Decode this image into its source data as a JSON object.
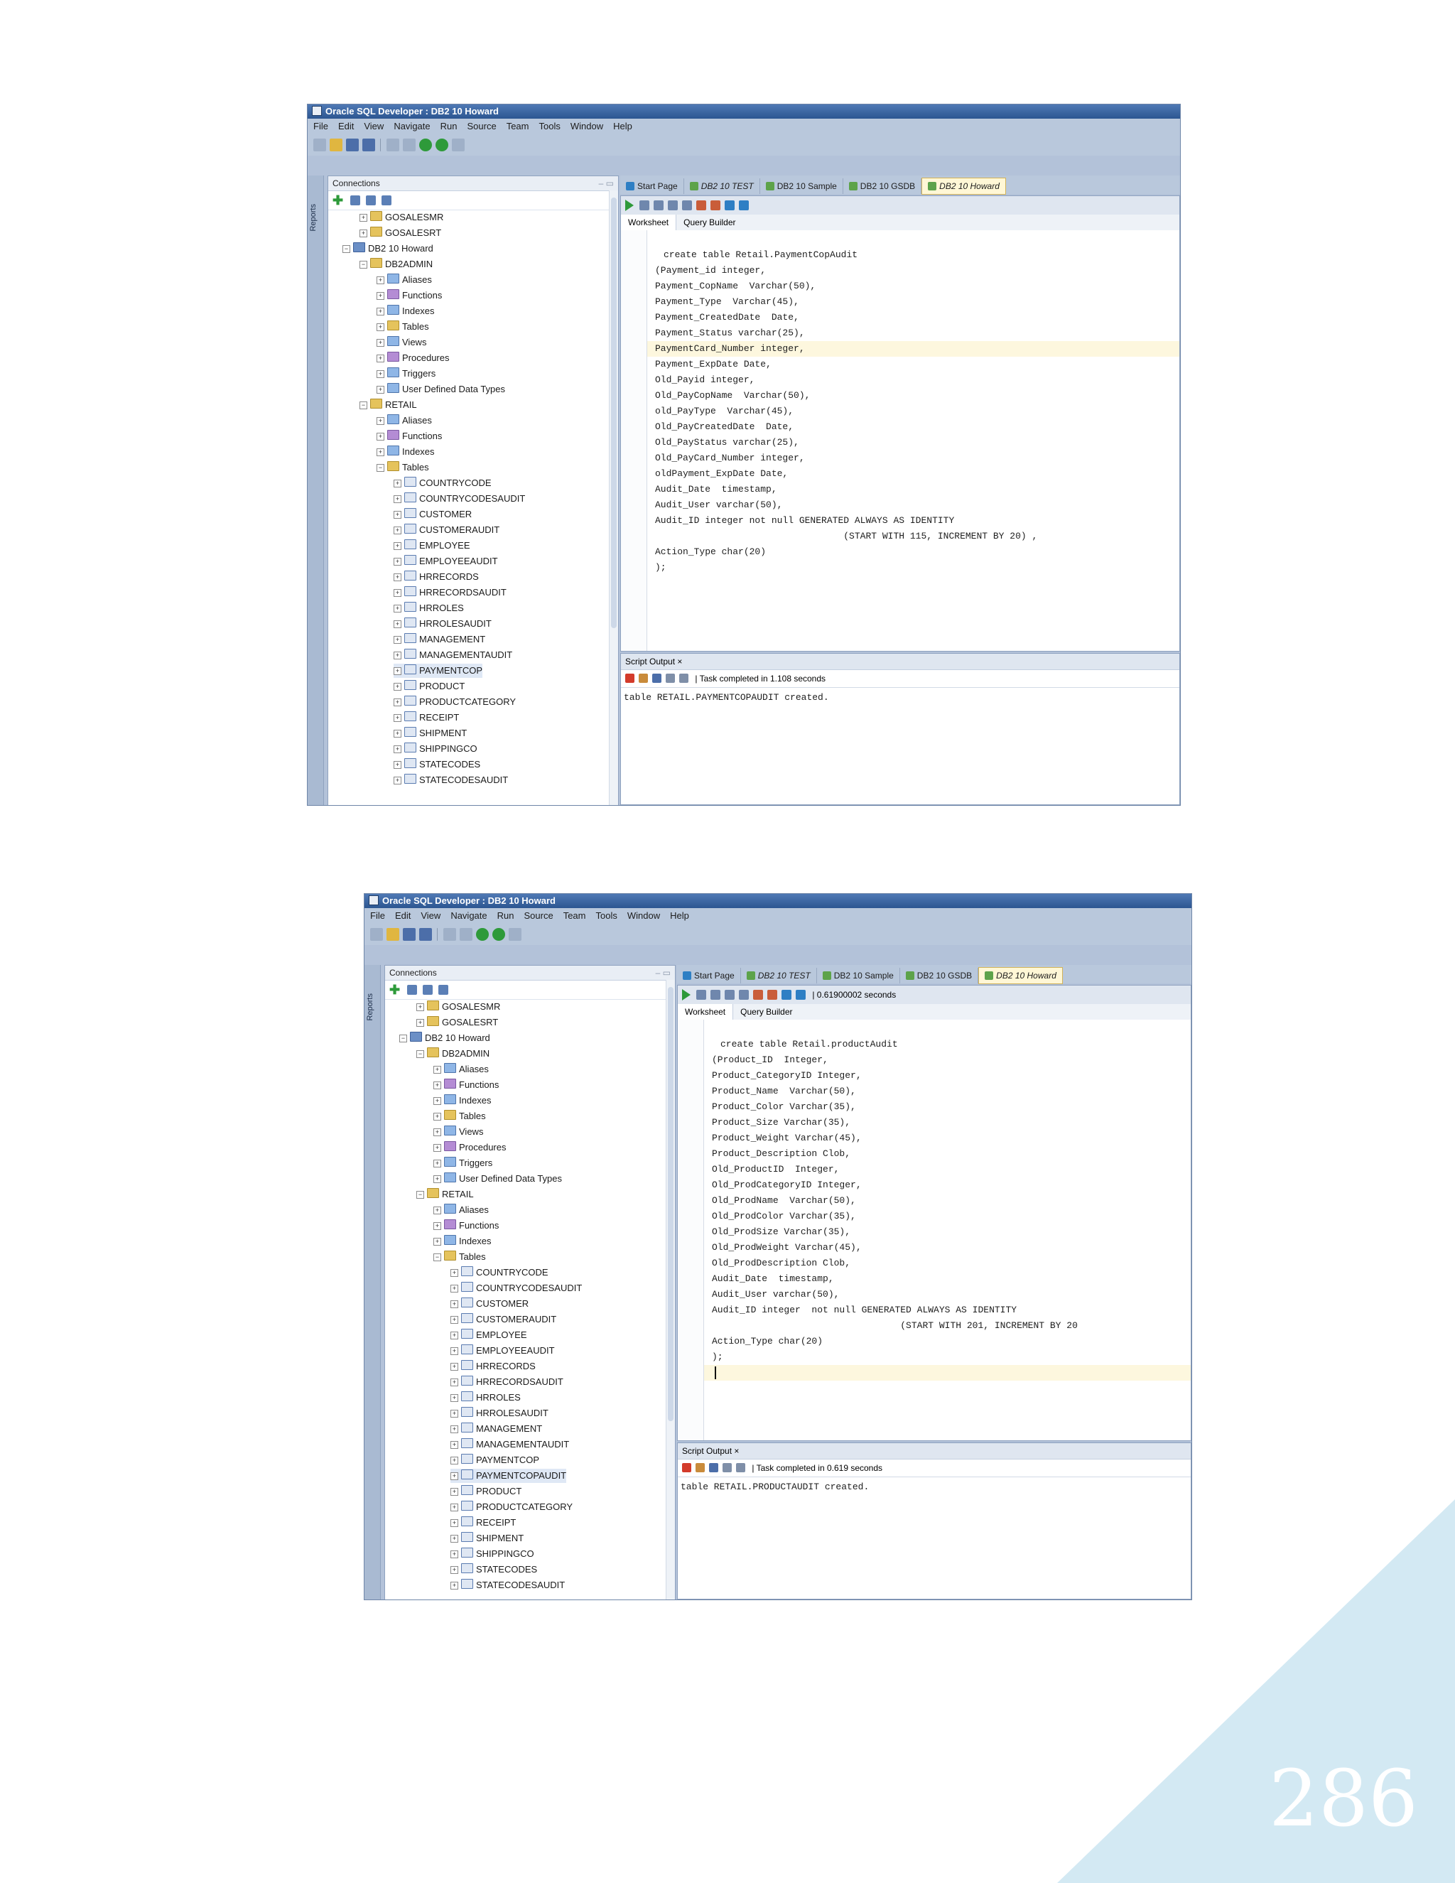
{
  "page_number": "286",
  "menu": [
    "File",
    "Edit",
    "View",
    "Navigate",
    "Run",
    "Source",
    "Team",
    "Tools",
    "Window",
    "Help"
  ],
  "screenshot1": {
    "title": "Oracle SQL Developer : DB2 10 Howard",
    "side_label": "Reports",
    "connections_title": "Connections",
    "tabs": [
      "Start Page",
      "DB2 10 TEST",
      "DB2 10 Sample",
      "DB2 10 GSDB",
      "DB2 10 Howard"
    ],
    "editor_tabs": [
      "Worksheet",
      "Query Builder"
    ],
    "tree": [
      "GOSALESMR",
      "GOSALESRT",
      "DB2 10 Howard",
      "DB2ADMIN",
      "Aliases",
      "Functions",
      "Indexes",
      "Tables",
      "Views",
      "Procedures",
      "Triggers",
      "User Defined Data Types",
      "RETAIL",
      "Aliases",
      "Functions",
      "Indexes",
      "Tables",
      "COUNTRYCODE",
      "COUNTRYCODESAUDIT",
      "CUSTOMER",
      "CUSTOMERAUDIT",
      "EMPLOYEE",
      "EMPLOYEEAUDIT",
      "HRRECORDS",
      "HRRECORDSAUDIT",
      "HRROLES",
      "HRROLESAUDIT",
      "MANAGEMENT",
      "MANAGEMENTAUDIT",
      "PAYMENTCOP",
      "PRODUCT",
      "PRODUCTCATEGORY",
      "RECEIPT",
      "SHIPMENT",
      "SHIPPINGCO",
      "STATECODES",
      "STATECODESAUDIT"
    ],
    "code": [
      "create table Retail.PaymentCopAudit",
      "(Payment_id integer,",
      "Payment_CopName  Varchar(50),",
      "Payment_Type  Varchar(45),",
      "Payment_CreatedDate  Date,",
      "Payment_Status varchar(25),",
      "PaymentCard_Number integer,",
      "Payment_ExpDate Date,",
      "Old_Payid integer,",
      "Old_PayCopName  Varchar(50),",
      "old_PayType  Varchar(45),",
      "Old_PayCreatedDate  Date,",
      "Old_PayStatus varchar(25),",
      "Old_PayCard_Number integer,",
      "oldPayment_ExpDate Date,",
      "Audit_Date  timestamp,",
      "Audit_User varchar(50),",
      "Audit_ID integer not null GENERATED ALWAYS AS IDENTITY",
      "                                  (START WITH 115, INCREMENT BY 20) ,",
      "Action_Type char(20)",
      ");"
    ],
    "output_tab": "Script Output",
    "status": "Task completed in 1.108 seconds",
    "output": "table RETAIL.PAYMENTCOPAUDIT created."
  },
  "screenshot2": {
    "title": "Oracle SQL Developer : DB2 10 Howard",
    "side_label": "Reports",
    "connections_title": "Connections",
    "tabs": [
      "Start Page",
      "DB2 10 TEST",
      "DB2 10 Sample",
      "DB2 10 GSDB",
      "DB2 10 Howard"
    ],
    "timing": "0.61900002 seconds",
    "editor_tabs": [
      "Worksheet",
      "Query Builder"
    ],
    "tree": [
      "GOSALESMR",
      "GOSALESRT",
      "DB2 10 Howard",
      "DB2ADMIN",
      "Aliases",
      "Functions",
      "Indexes",
      "Tables",
      "Views",
      "Procedures",
      "Triggers",
      "User Defined Data Types",
      "RETAIL",
      "Aliases",
      "Functions",
      "Indexes",
      "Tables",
      "COUNTRYCODE",
      "COUNTRYCODESAUDIT",
      "CUSTOMER",
      "CUSTOMERAUDIT",
      "EMPLOYEE",
      "EMPLOYEEAUDIT",
      "HRRECORDS",
      "HRRECORDSAUDIT",
      "HRROLES",
      "HRROLESAUDIT",
      "MANAGEMENT",
      "MANAGEMENTAUDIT",
      "PAYMENTCOP",
      "PAYMENTCOPAUDIT",
      "PRODUCT",
      "PRODUCTCATEGORY",
      "RECEIPT",
      "SHIPMENT",
      "SHIPPINGCO",
      "STATECODES",
      "STATECODESAUDIT"
    ],
    "code": [
      "create table Retail.productAudit",
      "(Product_ID  Integer,",
      "Product_CategoryID Integer,",
      "Product_Name  Varchar(50),",
      "Product_Color Varchar(35),",
      "Product_Size Varchar(35),",
      "Product_Weight Varchar(45),",
      "Product_Description Clob,",
      "Old_ProductID  Integer,",
      "Old_ProdCategoryID Integer,",
      "Old_ProdName  Varchar(50),",
      "Old_ProdColor Varchar(35),",
      "Old_ProdSize Varchar(35),",
      "Old_ProdWeight Varchar(45),",
      "Old_ProdDescription Clob,",
      "Audit_Date  timestamp,",
      "Audit_User varchar(50),",
      "Audit_ID integer  not null GENERATED ALWAYS AS IDENTITY",
      "                                  (START WITH 201, INCREMENT BY 20",
      "Action_Type char(20)",
      ");"
    ],
    "output_tab": "Script Output",
    "status": "Task completed in 0.619 seconds",
    "output": "table RETAIL.PRODUCTAUDIT created."
  }
}
